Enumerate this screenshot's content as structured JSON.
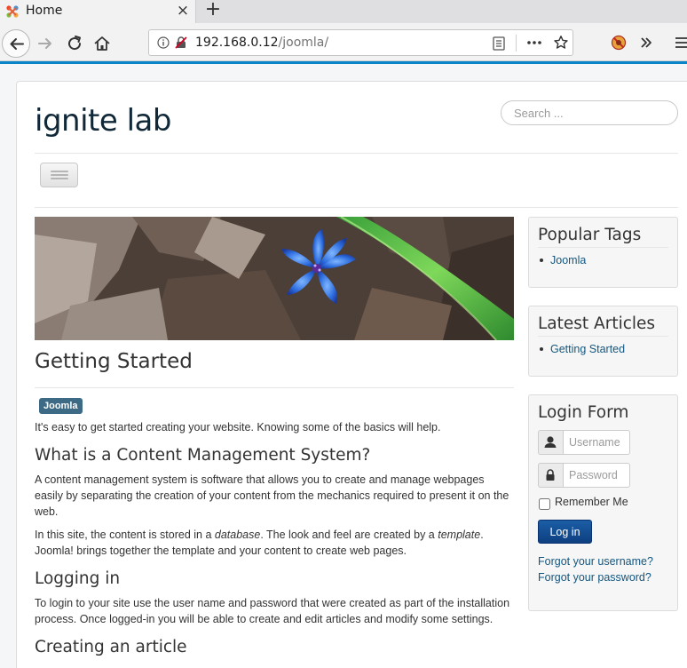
{
  "browser": {
    "tab_title": "Home",
    "tab_close": "×",
    "new_tab": "+",
    "url_host": "192.168.0.12",
    "url_path": "/joomla/"
  },
  "site": {
    "title": "ignite lab",
    "search_placeholder": "Search ..."
  },
  "article": {
    "title": "Getting Started",
    "tag": "Joomla",
    "intro": "It's easy to get started creating your website. Knowing some of the basics will help.",
    "h_cms": "What is a Content Management System?",
    "p_cms": "A content management system is software that allows you to create and manage webpages easily by separating the creation of your content from the mechanics required to present it on the web.",
    "p_site_1": "In this site, the content is stored in a ",
    "p_site_db": "database",
    "p_site_2": ". The look and feel are created by a ",
    "p_site_tpl": "template",
    "p_site_3": ". Joomla! brings together the template and your content to create web pages.",
    "h_login": "Logging in",
    "p_login": "To login to your site use the user name and password that were created as part of the installation process. Once logged-in you will be able to create and edit articles and modify some settings.",
    "h_next": "Creating an article"
  },
  "sidebar": {
    "popular_tags_title": "Popular Tags",
    "popular_tags": [
      "Joomla"
    ],
    "latest_title": "Latest Articles",
    "latest": [
      "Getting Started"
    ],
    "login": {
      "title": "Login Form",
      "username_placeholder": "Username",
      "password_placeholder": "Password",
      "remember": "Remember Me",
      "button": "Log in",
      "forgot_username": "Forgot your username?",
      "forgot_password": "Forgot your password?"
    }
  }
}
